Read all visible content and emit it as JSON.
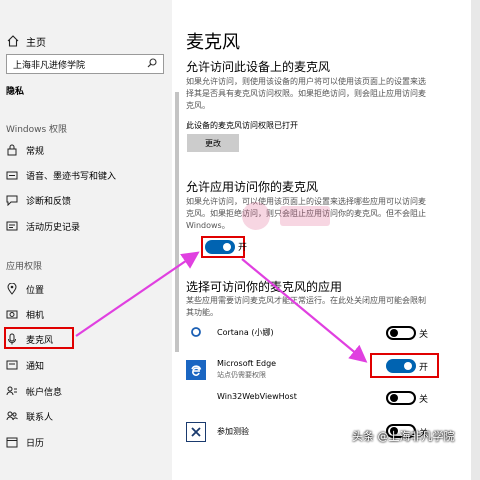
{
  "sidebar": {
    "home": "主页",
    "search_value": "上海非凡进修学院",
    "privacy": "隐私",
    "section_windows": "Windows 权限",
    "windows_items": [
      {
        "label": "常规",
        "icon": "lock-icon"
      },
      {
        "label": "语音、墨迹书写和键入",
        "icon": "pen-icon"
      },
      {
        "label": "诊断和反馈",
        "icon": "feedback-icon"
      },
      {
        "label": "活动历史记录",
        "icon": "history-icon"
      }
    ],
    "section_app": "应用权限",
    "app_items": [
      {
        "label": "位置",
        "icon": "location-icon"
      },
      {
        "label": "相机",
        "icon": "camera-icon"
      },
      {
        "label": "麦克风",
        "icon": "microphone-icon"
      },
      {
        "label": "通知",
        "icon": "notification-icon"
      },
      {
        "label": "帐户信息",
        "icon": "account-icon"
      },
      {
        "label": "联系人",
        "icon": "contacts-icon"
      },
      {
        "label": "日历",
        "icon": "calendar-icon"
      }
    ]
  },
  "main": {
    "title": "麦克风",
    "section1": {
      "heading": "允许访问此设备上的麦克风",
      "desc": "如果允许访问，则使用该设备的用户将可以使用该页面上的设置来选择其是否具有麦克风访问权限。如果拒绝访问，则会阻止应用访问麦克风。",
      "status": "此设备的麦克风访问权限已打开",
      "change_button": "更改"
    },
    "section2": {
      "heading": "允许应用访问你的麦克风",
      "desc": "如果允许访问，可以使用该页面上的设置来选择哪些应用可以访问麦克风。如果拒绝访问，则只会阻止应用访问你的麦克风。但不会阻止 Windows。",
      "toggle_label": "开",
      "toggle_on": true
    },
    "section3": {
      "heading": "选择可访问你的麦克风的应用",
      "desc": "某些应用需要访问麦克风才能正常运行。在此处关闭应用可能会限制其功能。",
      "apps": [
        {
          "name": "Cortana (小娜)",
          "sub": "",
          "toggle_label": "关",
          "on": false,
          "icon": "cortana-icon"
        },
        {
          "name": "Microsoft Edge",
          "sub": "站点仍需要权限",
          "toggle_label": "开",
          "on": true,
          "icon": "edge-icon"
        },
        {
          "name": "Win32WebViewHost",
          "sub": "",
          "toggle_label": "关",
          "on": false,
          "icon": "blank-app-icon"
        },
        {
          "name": "参加测验",
          "sub": "",
          "toggle_label": "关",
          "on": false,
          "icon": "quiz-icon"
        }
      ]
    }
  },
  "watermark": "头条 @上海非凡学院",
  "colors": {
    "accent": "#0063b1",
    "highlight": "#e00000",
    "arrow": "#e040e0"
  }
}
